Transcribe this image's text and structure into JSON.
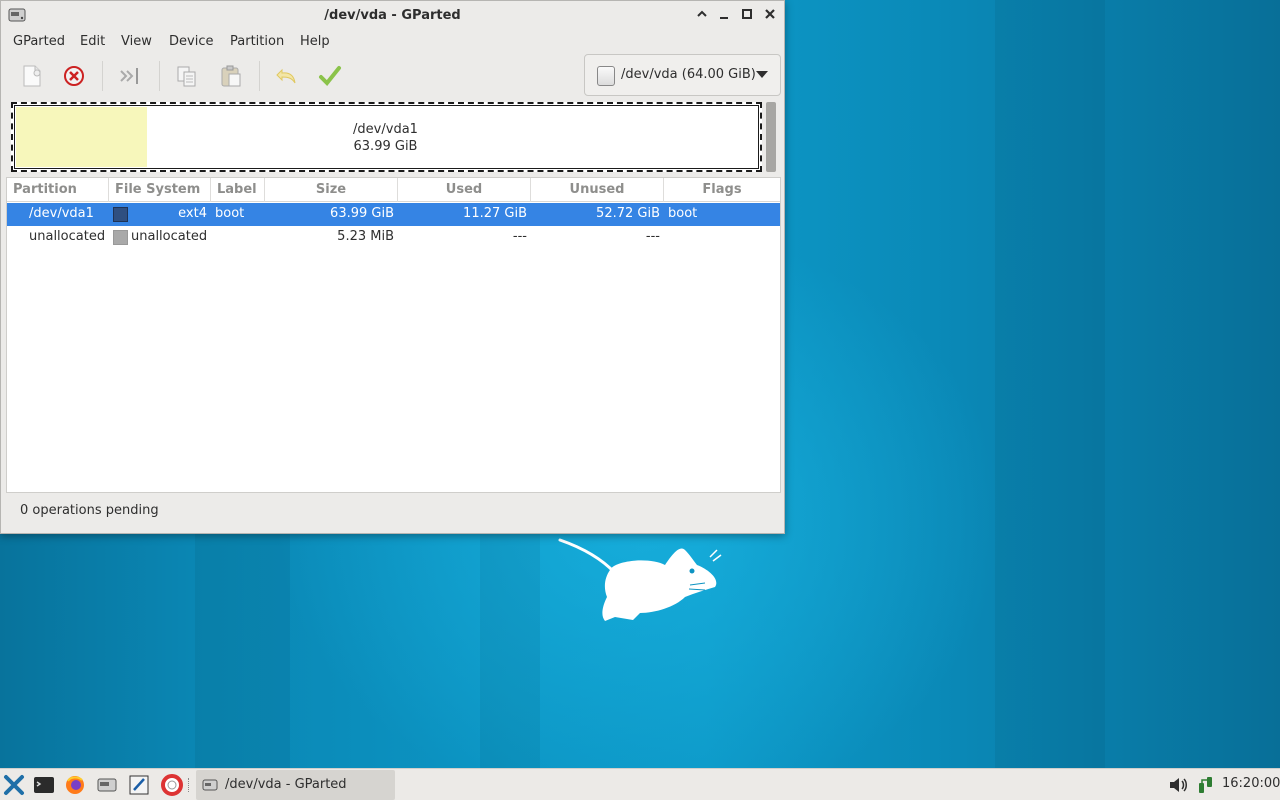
{
  "window": {
    "title": "/dev/vda - GParted",
    "controls": {
      "minimize": "^",
      "restore": "_",
      "maximize": "□",
      "close": "✕"
    }
  },
  "menu": [
    "GParted",
    "Edit",
    "View",
    "Device",
    "Partition",
    "Help"
  ],
  "toolbar": {
    "icons": [
      "new-partition-icon",
      "delete-partition-icon",
      "resize-move-icon",
      "copy-icon",
      "paste-icon",
      "undo-icon",
      "apply-icon"
    ]
  },
  "device_selector": {
    "value": "/dev/vda (64.00 GiB)"
  },
  "disk_map": {
    "name": "/dev/vda1",
    "size": "63.99 GiB",
    "used_fraction": 0.176
  },
  "table": {
    "columns": [
      "Partition",
      "File System",
      "Label",
      "Size",
      "Used",
      "Unused",
      "Flags"
    ],
    "rows": [
      {
        "partition": "/dev/vda1",
        "fs_color": "#2f4f80",
        "filesystem": "ext4",
        "label": "boot",
        "size": "63.99 GiB",
        "used": "11.27 GiB",
        "unused": "52.72 GiB",
        "flags": "boot",
        "selected": true
      },
      {
        "partition": "unallocated",
        "fs_color": "#a9a9a9",
        "filesystem": "unallocated",
        "label": "",
        "size": "5.23 MiB",
        "used": "---",
        "unused": "---",
        "flags": "",
        "selected": false
      }
    ]
  },
  "status": "0 operations pending",
  "taskbar": {
    "launchers": [
      "xfce-menu-icon",
      "terminal-icon",
      "firefox-icon",
      "gparted-icon",
      "text-editor-icon",
      "help-icon"
    ],
    "task_label": "/dev/vda - GParted",
    "clock": "16:20:00"
  },
  "colors": {
    "selection": "#3584e4",
    "used_space": "#f7f7bb",
    "desktop": "#0d93c2"
  }
}
